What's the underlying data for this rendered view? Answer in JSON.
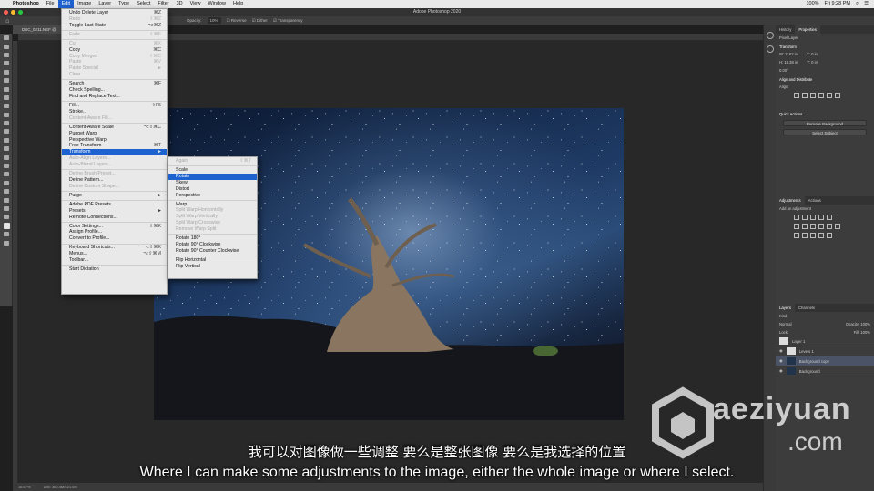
{
  "menubar": {
    "app": "Photoshop",
    "items": [
      "File",
      "Edit",
      "Image",
      "Layer",
      "Type",
      "Select",
      "Filter",
      "3D",
      "View",
      "Window",
      "Help"
    ],
    "active": "Edit",
    "battery": "100%",
    "clock": "Fri 9:28 PM"
  },
  "appbar": {
    "title": "Adobe Photoshop 2020"
  },
  "options": {
    "opacity_label": "Opacity:",
    "opacity_value": "10%",
    "reverse": "Reverse",
    "dither": "Dither",
    "transparency": "Transparency"
  },
  "doc": {
    "tab": "DSC_0211.NEF @ 16...",
    "zoom": "16.67%",
    "info": "Doc: 360.4M/521.0M"
  },
  "edit_menu": [
    {
      "label": "Undo Delete Layer",
      "shortcut": "⌘Z",
      "disabled": false
    },
    {
      "label": "Redo",
      "shortcut": "⇧⌘Z",
      "disabled": true
    },
    {
      "label": "Toggle Last State",
      "shortcut": "⌥⌘Z",
      "disabled": false
    },
    {
      "sep": true
    },
    {
      "label": "Fade...",
      "shortcut": "⇧⌘F",
      "disabled": true
    },
    {
      "sep": true
    },
    {
      "label": "Cut",
      "shortcut": "⌘X",
      "disabled": true
    },
    {
      "label": "Copy",
      "shortcut": "⌘C",
      "disabled": false
    },
    {
      "label": "Copy Merged",
      "shortcut": "⇧⌘C",
      "disabled": true
    },
    {
      "label": "Paste",
      "shortcut": "⌘V",
      "disabled": true
    },
    {
      "label": "Paste Special",
      "shortcut": "▶",
      "disabled": true
    },
    {
      "label": "Clear",
      "shortcut": "",
      "disabled": true
    },
    {
      "sep": true
    },
    {
      "label": "Search",
      "shortcut": "⌘F",
      "disabled": false
    },
    {
      "label": "Check Spelling...",
      "shortcut": "",
      "disabled": false
    },
    {
      "label": "Find and Replace Text...",
      "shortcut": "",
      "disabled": false
    },
    {
      "sep": true
    },
    {
      "label": "Fill...",
      "shortcut": "⇧F5",
      "disabled": false
    },
    {
      "label": "Stroke...",
      "shortcut": "",
      "disabled": false
    },
    {
      "label": "Content-Aware Fill...",
      "shortcut": "",
      "disabled": true
    },
    {
      "sep": true
    },
    {
      "label": "Content-Aware Scale",
      "shortcut": "⌥⇧⌘C",
      "disabled": false
    },
    {
      "label": "Puppet Warp",
      "shortcut": "",
      "disabled": false
    },
    {
      "label": "Perspective Warp",
      "shortcut": "",
      "disabled": false
    },
    {
      "label": "Free Transform",
      "shortcut": "⌘T",
      "disabled": false
    },
    {
      "label": "Transform",
      "shortcut": "▶",
      "disabled": false,
      "selected": true
    },
    {
      "label": "Auto-Align Layers...",
      "shortcut": "",
      "disabled": true
    },
    {
      "label": "Auto-Blend Layers...",
      "shortcut": "",
      "disabled": true
    },
    {
      "sep": true
    },
    {
      "label": "Define Brush Preset...",
      "shortcut": "",
      "disabled": true
    },
    {
      "label": "Define Pattern...",
      "shortcut": "",
      "disabled": false
    },
    {
      "label": "Define Custom Shape...",
      "shortcut": "",
      "disabled": true
    },
    {
      "sep": true
    },
    {
      "label": "Purge",
      "shortcut": "▶",
      "disabled": false
    },
    {
      "sep": true
    },
    {
      "label": "Adobe PDF Presets...",
      "shortcut": "",
      "disabled": false
    },
    {
      "label": "Presets",
      "shortcut": "▶",
      "disabled": false
    },
    {
      "label": "Remote Connections...",
      "shortcut": "",
      "disabled": false
    },
    {
      "sep": true
    },
    {
      "label": "Color Settings...",
      "shortcut": "⇧⌘K",
      "disabled": false
    },
    {
      "label": "Assign Profile...",
      "shortcut": "",
      "disabled": false
    },
    {
      "label": "Convert to Profile...",
      "shortcut": "",
      "disabled": false
    },
    {
      "sep": true
    },
    {
      "label": "Keyboard Shortcuts...",
      "shortcut": "⌥⇧⌘K",
      "disabled": false
    },
    {
      "label": "Menus...",
      "shortcut": "⌥⇧⌘M",
      "disabled": false
    },
    {
      "label": "Toolbar...",
      "shortcut": "",
      "disabled": false
    },
    {
      "sep": true
    },
    {
      "label": "Start Dictation",
      "shortcut": "",
      "disabled": false
    }
  ],
  "transform_menu": [
    {
      "label": "Again",
      "shortcut": "⇧⌘T",
      "disabled": true
    },
    {
      "sep": true
    },
    {
      "label": "Scale",
      "disabled": false
    },
    {
      "label": "Rotate",
      "disabled": false,
      "selected": true
    },
    {
      "label": "Skew",
      "disabled": false
    },
    {
      "label": "Distort",
      "disabled": false
    },
    {
      "label": "Perspective",
      "disabled": false
    },
    {
      "sep": true
    },
    {
      "label": "Warp",
      "disabled": false
    },
    {
      "label": "Split Warp Horizontally",
      "disabled": true
    },
    {
      "label": "Split Warp Vertically",
      "disabled": true
    },
    {
      "label": "Split Warp Crosswise",
      "disabled": true
    },
    {
      "label": "Remove Warp Split",
      "disabled": true
    },
    {
      "sep": true
    },
    {
      "label": "Rotate 180°",
      "disabled": false
    },
    {
      "label": "Rotate 90° Clockwise",
      "disabled": false
    },
    {
      "label": "Rotate 90° Counter Clockwise",
      "disabled": false
    },
    {
      "sep": true
    },
    {
      "label": "Flip Horizontal",
      "disabled": false
    },
    {
      "label": "Flip Vertical",
      "disabled": false
    }
  ],
  "panels": {
    "top_tabs": [
      "History",
      "Properties"
    ],
    "pixel_layer": "Pixel Layer",
    "transform": "Transform",
    "w": "W: 2162 in",
    "h": "H: 16.38 in",
    "x": "X: 0 in",
    "y": "Y: 0 in",
    "angle": "0.00°",
    "align_distribute": "Align and Distribute",
    "align": "Align:",
    "quick_actions": "Quick Actions",
    "remove_bg": "Remove Background",
    "select_subject": "Select Subject",
    "mid_tabs": [
      "Adjustments",
      "Actions"
    ],
    "add_adjustment": "Add an adjustment",
    "layer_tabs": [
      "Layers",
      "Channels"
    ],
    "kind": "Kind",
    "blend": "Normal",
    "opacity": "Opacity: 100%",
    "lock": "Lock:",
    "fill": "Fill: 100%",
    "layers": [
      "Layer 1",
      "Levels 1",
      "Background copy",
      "Background"
    ]
  },
  "watermark": {
    "name": "aeziyuan",
    "suffix": ".com"
  },
  "subtitles": {
    "cn": "我可以对图像做一些调整 要么是整张图像 要么是我选择的位置",
    "en": "Where I can make some adjustments to the image, either the whole image or where I select."
  },
  "colors": {
    "menu_highlight": "#1e62d0",
    "ps_dark": "#282828",
    "panel": "#3c3c3c"
  }
}
